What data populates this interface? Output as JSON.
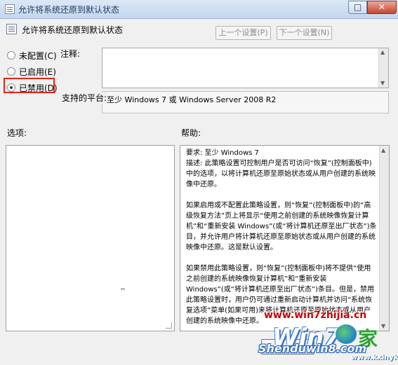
{
  "window": {
    "title": "允许将系统还原到默认状态",
    "maximize_glyph": "□",
    "close_glyph": "✕"
  },
  "header": {
    "title": "允许将系统还原到默认状态",
    "prev_label": "上一个设置(P)",
    "next_label": "下一个设置(N)"
  },
  "radios": [
    {
      "label": "未配置(C)",
      "checked": false
    },
    {
      "label": "已启用(E)",
      "checked": false
    },
    {
      "label": "已禁用(D)",
      "checked": true
    }
  ],
  "labels": {
    "comment": "注释:",
    "platform": "支持的平台:",
    "options": "选项:",
    "help": "帮助:"
  },
  "platform_value": "至少 Windows 7 或 Windows Server 2008 R2",
  "help": {
    "p1_line1": "要求: 至少 Windows 7",
    "p1_rest": "描述: 此策略设置可控制用户是否可访问“恢复”(控制面板中)中的选项，以将计算机还原至原始状态或从用户创建的系统映像中还原。",
    "p2": "如果启用或不配置此策略设置，则“恢复”(控制面板中)的“高级恢复方法”页上将显示“使用之前创建的系统映像恢复计算机”和“重新安装 Windows”(或“将计算机还原至出厂状态”)条目，并允许用户将计算机还原至原始状态或从用户创建的系统映像中还原。这是默认设置。",
    "p3": "如果禁用此策略设置，则“恢复”(控制面板中)将不提供“使用之前创建的系统映像恢复计算机”和“重新安装 Windows”(或“将计算机还原至出厂状态”)条目。但是，禁用此策略设置时，用户仍可通过重新启动计算机并访问“系统恢复选项”菜单(如果可用)来将计算机还原至原始状态或从用户创建的系统映像中还原。"
  },
  "watermark": {
    "url": "www.win7zhijia.cn",
    "logo": "Win7",
    "jia": "家",
    "site": "Shenduwin8.com",
    "small": "www.kxinyk.com"
  },
  "colors": {
    "highlight_border": "#e2231a",
    "radio_dot": "#1d3d74"
  }
}
